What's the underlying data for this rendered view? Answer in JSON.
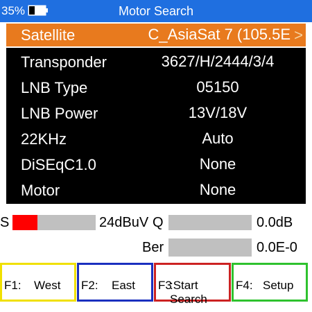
{
  "status": {
    "battery_pct": "35%",
    "battery_level": 0.35,
    "battery_icon": "battery-icon"
  },
  "title": "Motor Search",
  "menu": [
    {
      "label": "Satellite",
      "value": "C_AsiaSat 7 (105.5E",
      "selected": true
    },
    {
      "label": "Transponder",
      "value": "3627/H/2444/3/4"
    },
    {
      "label": "LNB Type",
      "value": "05150"
    },
    {
      "label": "LNB Power",
      "value": "13V/18V"
    },
    {
      "label": "22KHz",
      "value": "Auto"
    },
    {
      "label": "DiSEqC1.0",
      "value": "None"
    },
    {
      "label": "Motor",
      "value": "None"
    }
  ],
  "selected_arrow": ">",
  "signal": {
    "s_label": "S",
    "s_value": "24dBuV",
    "s_level": 0.3,
    "s_color": "#ff0000",
    "q_label": "Q",
    "q_value": "0.0dB",
    "q_level": 0,
    "ber_label": "Ber",
    "ber_value": "0.0E-0",
    "ber_level": 0
  },
  "fkeys": [
    {
      "num": "F1:",
      "label": "West",
      "color": "#f0e000"
    },
    {
      "num": "F2:",
      "label": "East",
      "color": "#1a2fbf"
    },
    {
      "num": "F3:",
      "label": "Start Search",
      "color": "#cc2222"
    },
    {
      "num": "F4:",
      "label": "Setup",
      "color": "#2ec22e"
    }
  ],
  "colors": {
    "titlebar": "#1f6fe0",
    "highlight": "#e87a1e",
    "menu_bg": "#000000"
  }
}
